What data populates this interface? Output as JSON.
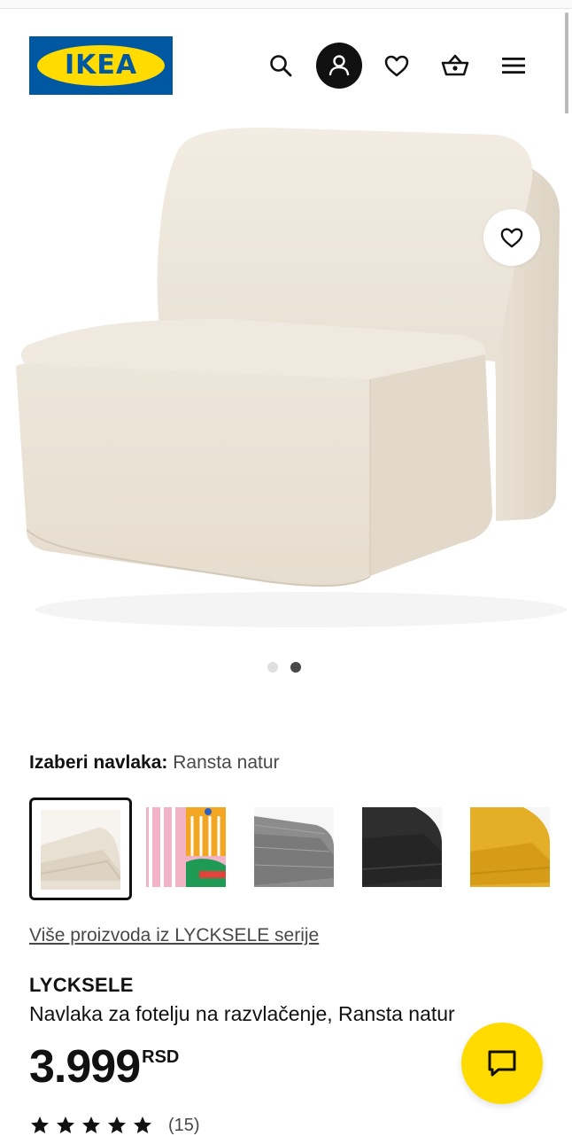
{
  "brand_logo": {
    "text": "IKEA",
    "colors": {
      "blue": "#0058a3",
      "yellow": "#ffdb00"
    }
  },
  "header": {
    "icons": [
      "search-icon",
      "user-icon",
      "heart-icon",
      "basket-icon",
      "menu-icon"
    ]
  },
  "gallery": {
    "image_count": 2,
    "active_index": 1,
    "favorite_icon": "heart-icon"
  },
  "variant": {
    "label": "Izaberi navlaka:",
    "selected": "Ransta natur",
    "swatches": [
      {
        "color": "#e7dfd2",
        "selected": true
      },
      {
        "color": "#f1b4c6",
        "selected": false
      },
      {
        "color": "#8a8a8a",
        "selected": false
      },
      {
        "color": "#2b2b2b",
        "selected": false
      },
      {
        "color": "#e3ac22",
        "selected": false
      }
    ]
  },
  "product": {
    "series_link": "Više proizvoda iz LYCKSELE serije",
    "name": "LYCKSELE",
    "description": "Navlaka za fotelju na razvlačenje, Ransta natur",
    "price": "3.999",
    "currency": "RSD",
    "rating": 5,
    "review_count": "(15)"
  },
  "chat": {
    "icon": "chat-icon",
    "color": "#ffdb00"
  }
}
